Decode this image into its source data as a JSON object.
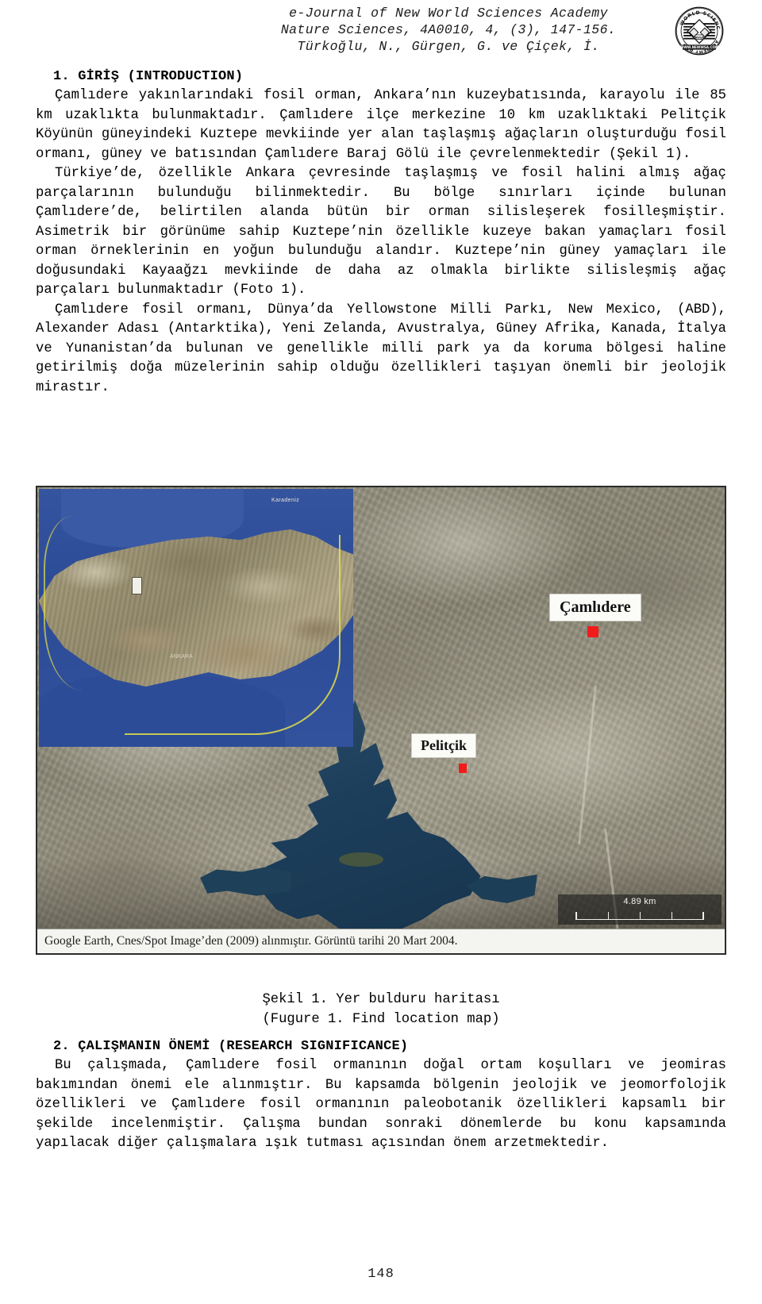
{
  "header": {
    "line1": "e-Journal of New World Sciences Academy",
    "line2": "Nature Sciences, 4A0010, 4, (3), 147-156.",
    "line3": "Türkoğlu, N., Gürgen, G. ve Çiçek, İ.",
    "logo_text_top": "WORLD SCIENCES",
    "logo_text_bottom": "WWW.NEWWSA.COM",
    "logo_center": "NWSA"
  },
  "section1": {
    "heading": "1. GİRİŞ (INTRODUCTION)",
    "paragraphs": [
      "Çamlıdere yakınlarındaki fosil orman, Ankara’nın kuzeybatısında, karayolu ile 85 km uzaklıkta bulunmaktadır. Çamlıdere ilçe merkezine 10 km uzaklıktaki Pelitçik Köyünün güneyindeki Kuztepe mevkiinde yer alan taşlaşmış ağaçların oluşturduğu fosil ormanı, güney ve batısından Çamlıdere Baraj Gölü ile çevrelenmektedir (Şekil 1).",
      "Türkiye’de, özellikle Ankara çevresinde taşlaşmış ve fosil halini almış ağaç parçalarının bulunduğu bilinmektedir. Bu bölge sınırları içinde bulunan Çamlıdere’de, belirtilen alanda bütün bir orman silisleşerek fosilleşmiştir. Asimetrik bir görünüme sahip Kuztepe’nin özellikle kuzeye bakan yamaçları fosil orman örneklerinin en yoğun bulunduğu alandır. Kuztepe’nin güney yamaçları ile doğusundaki Kayaağzı mevkiinde de daha az olmakla birlikte silisleşmiş ağaç parçaları bulunmaktadır (Foto 1).",
      "Çamlıdere fosil ormanı, Dünya’da Yellowstone Milli Parkı, New Mexico, (ABD), Alexander Adası (Antarktika), Yeni Zelanda, Avustralya, Güney Afrika, Kanada, İtalya ve Yunanistan’da bulunan ve genellikle milli park ya da koruma bölgesi haline getirilmiş doğa müzelerinin sahip olduğu özellikleri taşıyan önemli bir jeolojik mirastır."
    ]
  },
  "figure": {
    "map_labels": {
      "camlidere": "Çamlıdere",
      "pelitcik": "Pelitçik",
      "inset_label_1": "Karadeniz",
      "inset_label_2": "ANKARA"
    },
    "scale_bar": "4.89 km",
    "attribution": "Google Earth, Cnes/Spot Image’den (2009) alınmıştır. Görüntü tarihi 20 Mart 2004.",
    "caption_tr": "Şekil 1. Yer bulduru haritası",
    "caption_en": "(Fugure 1. Find location map)"
  },
  "section2": {
    "heading": "2. ÇALIŞMANIN ÖNEMİ (RESEARCH SIGNIFICANCE)",
    "paragraphs": [
      "Bu çalışmada, Çamlıdere fosil ormanının doğal ortam koşulları ve jeomiras bakımından önemi ele alınmıştır. Bu kapsamda bölgenin jeolojik ve jeomorfolojik özellikleri ve Çamlıdere fosil ormanının paleobotanik özellikleri kapsamlı bir şekilde incelenmiştir. Çalışma bundan sonraki dönemlerde bu konu kapsamında yapılacak diğer çalışmalara ışık tutması açısından önem arzetmektedir."
    ]
  },
  "footer": {
    "page_number": "148"
  },
  "colors": {
    "text": "#000000",
    "marker_red": "#f21b1b",
    "water_blue": "#1d3f5c",
    "inset_sea": "#2f4fa0",
    "terrain": "#908c7b"
  }
}
